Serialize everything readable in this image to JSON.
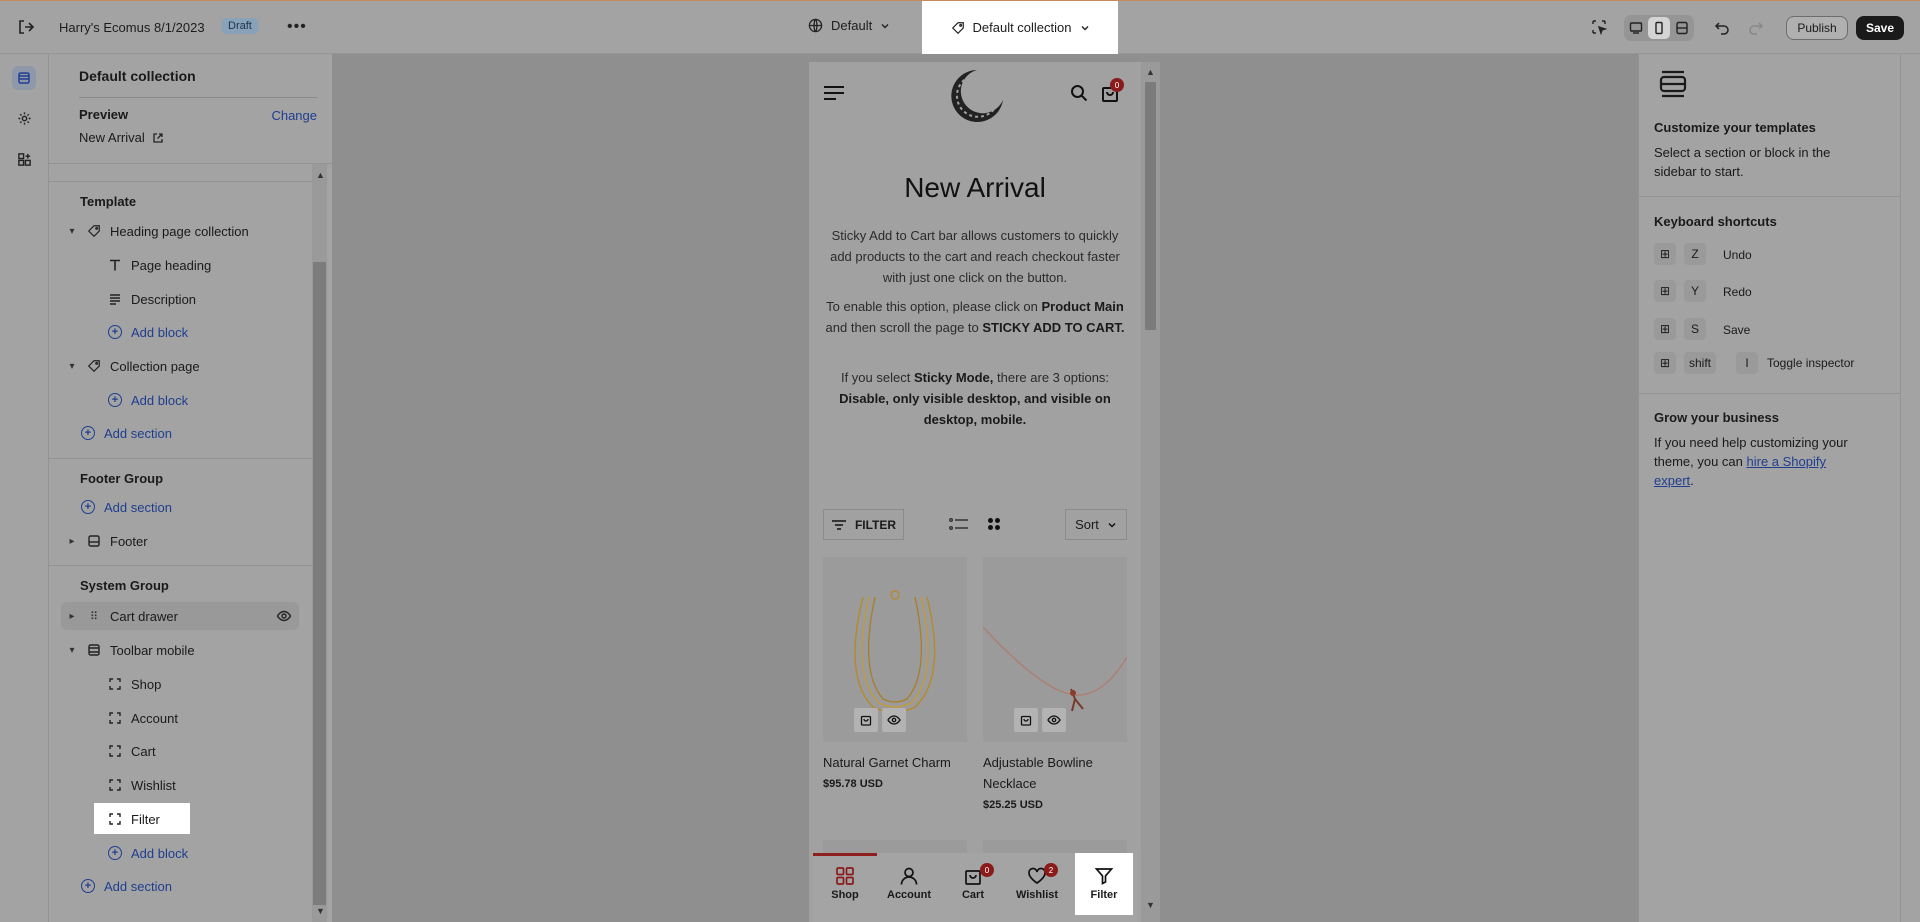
{
  "topbar": {
    "title": "Harry's Ecomus 8/1/2023",
    "badge": "Draft",
    "more": "•••",
    "theme_selector": "Default",
    "template_selector": "Default collection",
    "publish_label": "Publish",
    "save_label": "Save"
  },
  "popover": {
    "heading": "Default collection",
    "preview_label": "Preview",
    "change_label": "Change",
    "preview_value": "New Arrival"
  },
  "sidebar": {
    "template_header": "Template",
    "heading_section": "Heading page collection",
    "page_heading": "Page heading",
    "description": "Description",
    "add_block": "Add block",
    "collection_section": "Collection page",
    "add_section": "Add section",
    "footer_group": "Footer Group",
    "footer": "Footer",
    "system_group": "System Group",
    "cart_drawer": "Cart drawer",
    "toolbar_mobile": "Toolbar mobile",
    "toolbar_items": [
      "Shop",
      "Account",
      "Cart",
      "Wishlist",
      "Filter"
    ]
  },
  "preview": {
    "cart_count": "0",
    "title": "New Arrival",
    "para1": "Sticky Add to Cart bar allows customers to quickly add products to the cart and reach checkout faster with just one click on the button.",
    "para2_pre": "To enable this option, please click on ",
    "para2_b1": "Product Main",
    "para2_mid": " and then scroll the page to ",
    "para2_b2": "STICKY ADD TO CART.",
    "para3_pre": "If you select ",
    "para3_b1": "Sticky Mode,",
    "para3_mid": " there are 3 options: ",
    "para3_b2": "Disable, only visible desktop, and visible on desktop, mobile.",
    "filter_label": "FILTER",
    "sort_label": "Sort",
    "products": [
      {
        "name": "Natural Garnet Charm",
        "price": "$95.78 USD"
      },
      {
        "name": "Adjustable Bowline Necklace",
        "price": "$25.25 USD"
      }
    ],
    "toolbar": [
      {
        "label": "Shop",
        "icon": "grid-icon"
      },
      {
        "label": "Account",
        "icon": "user-icon"
      },
      {
        "label": "Cart",
        "icon": "bag-icon",
        "count": "0"
      },
      {
        "label": "Wishlist",
        "icon": "heart-icon",
        "count": "2"
      },
      {
        "label": "Filter",
        "icon": "filter-icon"
      }
    ]
  },
  "right_panel": {
    "customize_title": "Customize your templates",
    "customize_text": "Select a section or block in the sidebar to start.",
    "shortcuts_title": "Keyboard shortcuts",
    "shortcuts": [
      {
        "key": "Z",
        "label": "Undo"
      },
      {
        "key": "Y",
        "label": "Redo"
      },
      {
        "key": "S",
        "label": "Save"
      }
    ],
    "toggle_key1": "shift",
    "toggle_key2": "I",
    "toggle_label": "Toggle inspector",
    "grow_title": "Grow your business",
    "grow_text": "If you need help customizing your theme, you can ",
    "grow_link": "hire a Shopify expert",
    "grow_end": "."
  },
  "colors": {
    "accent": "#1f3e8f",
    "badge": "#8b1a1a",
    "save_bg": "#1a1a1a"
  }
}
